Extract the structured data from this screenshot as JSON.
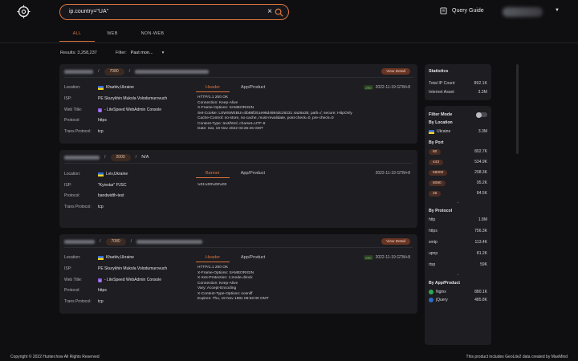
{
  "header": {
    "search_value": "ip.country=\"UA\"",
    "query_guide": "Query Guide",
    "user_name": "Zowa"
  },
  "tabs": [
    "ALL",
    "WEB",
    "NON-WEB"
  ],
  "results": {
    "label": "Results: 3,258,237"
  },
  "filter": {
    "label": "Filter:",
    "value": "Past mon..."
  },
  "labels": {
    "location": "Location:",
    "isp": "ISP:",
    "web_title": "Web Title:",
    "protocol": "Protocol:",
    "trans_protocol": "Trans Protocol:",
    "view_detail": "View Detail",
    "header_tab": "Header",
    "banner_tab": "Banner",
    "app_tab": "App/Product"
  },
  "cards": [
    {
      "port": "7080",
      "location": "Kharkiv,Ukraine",
      "isp": "PE Skurykhin Mukola Volodumurovuch",
      "web_title": "- LiteSpeed WebAdmin Console",
      "protocol": "https",
      "trans_protocol": "tcp",
      "status_code": "200",
      "timestamp": "2022-11-19 GTM+8",
      "banner": "HTTP/1.1 200 OK\nConnection: Keep-Alive\nX-Frame-Options: SAMEORIGIN\nSet-Cookie: LSWSWEBUI=bb88f251e96d4984dc26231 4a26a35; path=/; secure; HttpOnly\nCache-Control: no-store, no-cache, must-revalidate, post-check=0, pre-check=0\nContent-Type: text/html; charset=UTF-8\nDate: Sat, 19 Nov 2022 03:25:45 GMT"
    },
    {
      "port": "2000",
      "port_name": "N/A",
      "location": "Lviv,Ukraine",
      "isp": "\"Kyivstar\" PJSC",
      "protocol": "bandwidth-test",
      "trans_protocol": "tcp",
      "timestamp": "2022-11-19 GTM+8",
      "banner": "\\x01\\x00\\x00\\x00"
    },
    {
      "port": "7080",
      "location": "Kharkiv,Ukraine",
      "isp": "PE Skurykhin Mukola Volodumurovuch",
      "web_title": "- LiteSpeed WebAdmin Console",
      "protocol": "https",
      "trans_protocol": "tcp",
      "status_code": "200",
      "timestamp": "2022-11-19 GTM+8",
      "banner": "HTTP/1.1 200 OK\nX-Frame-Options: SAMEORIGIN\nX-Xss-Protection: 1;mode=block\nConnection: Keep-Alive\nVary: Accept-Encoding\nX-Content-Type-Options: nosniff\nExpires: Thu, 19 Nov 1981 08:52:00 GMT"
    }
  ],
  "stats": {
    "title": "Statistics",
    "ip_label": "Total IP Count",
    "ip_value": "892.1K",
    "asset_label": "Internet Asset",
    "asset_value": "3.3M"
  },
  "filters": {
    "mode_label": "Filter Mode",
    "by_location": "By Location",
    "location_name": "Ukraine",
    "location_count": "3.3M",
    "by_port": "By Port",
    "ports": [
      {
        "port": "80",
        "count": "802.7K"
      },
      {
        "port": "443",
        "count": "534.9K"
      },
      {
        "port": "58000",
        "count": "208.3K"
      },
      {
        "port": "8080",
        "count": "95.2K"
      },
      {
        "port": "25",
        "count": "84.5K"
      }
    ],
    "by_protocol": "By Protocol",
    "protocols": [
      {
        "name": "http",
        "count": "1.8M"
      },
      {
        "name": "https",
        "count": "756.3K"
      },
      {
        "name": "smtp",
        "count": "113.4K"
      },
      {
        "name": "upnp",
        "count": "81.2K"
      },
      {
        "name": "rtsp",
        "count": "59K"
      }
    ],
    "by_app": "By App/Product",
    "apps": [
      {
        "name": "Nginx",
        "count": "880.1K"
      },
      {
        "name": "jQuery",
        "count": "485.8K"
      }
    ]
  },
  "footer": {
    "left": "Copyright © 2022 Hunter.how All Rights Reserved",
    "right": "This product includes GeoLite2 data created by MaxMind"
  },
  "colors": {
    "accent": "#d9743c",
    "card": "#1d1d22",
    "background": "#0f0f12"
  }
}
